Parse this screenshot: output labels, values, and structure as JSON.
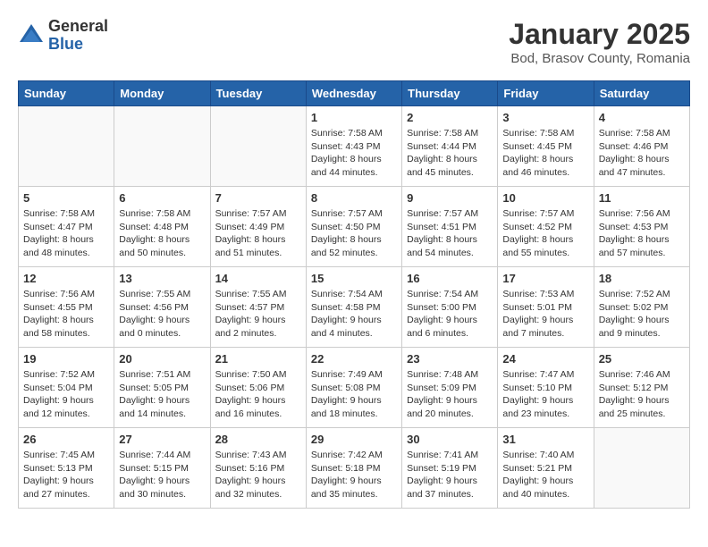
{
  "logo": {
    "general": "General",
    "blue": "Blue"
  },
  "title": "January 2025",
  "location": "Bod, Brasov County, Romania",
  "days_of_week": [
    "Sunday",
    "Monday",
    "Tuesday",
    "Wednesday",
    "Thursday",
    "Friday",
    "Saturday"
  ],
  "weeks": [
    [
      {
        "day": "",
        "info": ""
      },
      {
        "day": "",
        "info": ""
      },
      {
        "day": "",
        "info": ""
      },
      {
        "day": "1",
        "info": "Sunrise: 7:58 AM\nSunset: 4:43 PM\nDaylight: 8 hours\nand 44 minutes."
      },
      {
        "day": "2",
        "info": "Sunrise: 7:58 AM\nSunset: 4:44 PM\nDaylight: 8 hours\nand 45 minutes."
      },
      {
        "day": "3",
        "info": "Sunrise: 7:58 AM\nSunset: 4:45 PM\nDaylight: 8 hours\nand 46 minutes."
      },
      {
        "day": "4",
        "info": "Sunrise: 7:58 AM\nSunset: 4:46 PM\nDaylight: 8 hours\nand 47 minutes."
      }
    ],
    [
      {
        "day": "5",
        "info": "Sunrise: 7:58 AM\nSunset: 4:47 PM\nDaylight: 8 hours\nand 48 minutes."
      },
      {
        "day": "6",
        "info": "Sunrise: 7:58 AM\nSunset: 4:48 PM\nDaylight: 8 hours\nand 50 minutes."
      },
      {
        "day": "7",
        "info": "Sunrise: 7:57 AM\nSunset: 4:49 PM\nDaylight: 8 hours\nand 51 minutes."
      },
      {
        "day": "8",
        "info": "Sunrise: 7:57 AM\nSunset: 4:50 PM\nDaylight: 8 hours\nand 52 minutes."
      },
      {
        "day": "9",
        "info": "Sunrise: 7:57 AM\nSunset: 4:51 PM\nDaylight: 8 hours\nand 54 minutes."
      },
      {
        "day": "10",
        "info": "Sunrise: 7:57 AM\nSunset: 4:52 PM\nDaylight: 8 hours\nand 55 minutes."
      },
      {
        "day": "11",
        "info": "Sunrise: 7:56 AM\nSunset: 4:53 PM\nDaylight: 8 hours\nand 57 minutes."
      }
    ],
    [
      {
        "day": "12",
        "info": "Sunrise: 7:56 AM\nSunset: 4:55 PM\nDaylight: 8 hours\nand 58 minutes."
      },
      {
        "day": "13",
        "info": "Sunrise: 7:55 AM\nSunset: 4:56 PM\nDaylight: 9 hours\nand 0 minutes."
      },
      {
        "day": "14",
        "info": "Sunrise: 7:55 AM\nSunset: 4:57 PM\nDaylight: 9 hours\nand 2 minutes."
      },
      {
        "day": "15",
        "info": "Sunrise: 7:54 AM\nSunset: 4:58 PM\nDaylight: 9 hours\nand 4 minutes."
      },
      {
        "day": "16",
        "info": "Sunrise: 7:54 AM\nSunset: 5:00 PM\nDaylight: 9 hours\nand 6 minutes."
      },
      {
        "day": "17",
        "info": "Sunrise: 7:53 AM\nSunset: 5:01 PM\nDaylight: 9 hours\nand 7 minutes."
      },
      {
        "day": "18",
        "info": "Sunrise: 7:52 AM\nSunset: 5:02 PM\nDaylight: 9 hours\nand 9 minutes."
      }
    ],
    [
      {
        "day": "19",
        "info": "Sunrise: 7:52 AM\nSunset: 5:04 PM\nDaylight: 9 hours\nand 12 minutes."
      },
      {
        "day": "20",
        "info": "Sunrise: 7:51 AM\nSunset: 5:05 PM\nDaylight: 9 hours\nand 14 minutes."
      },
      {
        "day": "21",
        "info": "Sunrise: 7:50 AM\nSunset: 5:06 PM\nDaylight: 9 hours\nand 16 minutes."
      },
      {
        "day": "22",
        "info": "Sunrise: 7:49 AM\nSunset: 5:08 PM\nDaylight: 9 hours\nand 18 minutes."
      },
      {
        "day": "23",
        "info": "Sunrise: 7:48 AM\nSunset: 5:09 PM\nDaylight: 9 hours\nand 20 minutes."
      },
      {
        "day": "24",
        "info": "Sunrise: 7:47 AM\nSunset: 5:10 PM\nDaylight: 9 hours\nand 23 minutes."
      },
      {
        "day": "25",
        "info": "Sunrise: 7:46 AM\nSunset: 5:12 PM\nDaylight: 9 hours\nand 25 minutes."
      }
    ],
    [
      {
        "day": "26",
        "info": "Sunrise: 7:45 AM\nSunset: 5:13 PM\nDaylight: 9 hours\nand 27 minutes."
      },
      {
        "day": "27",
        "info": "Sunrise: 7:44 AM\nSunset: 5:15 PM\nDaylight: 9 hours\nand 30 minutes."
      },
      {
        "day": "28",
        "info": "Sunrise: 7:43 AM\nSunset: 5:16 PM\nDaylight: 9 hours\nand 32 minutes."
      },
      {
        "day": "29",
        "info": "Sunrise: 7:42 AM\nSunset: 5:18 PM\nDaylight: 9 hours\nand 35 minutes."
      },
      {
        "day": "30",
        "info": "Sunrise: 7:41 AM\nSunset: 5:19 PM\nDaylight: 9 hours\nand 37 minutes."
      },
      {
        "day": "31",
        "info": "Sunrise: 7:40 AM\nSunset: 5:21 PM\nDaylight: 9 hours\nand 40 minutes."
      },
      {
        "day": "",
        "info": ""
      }
    ]
  ]
}
